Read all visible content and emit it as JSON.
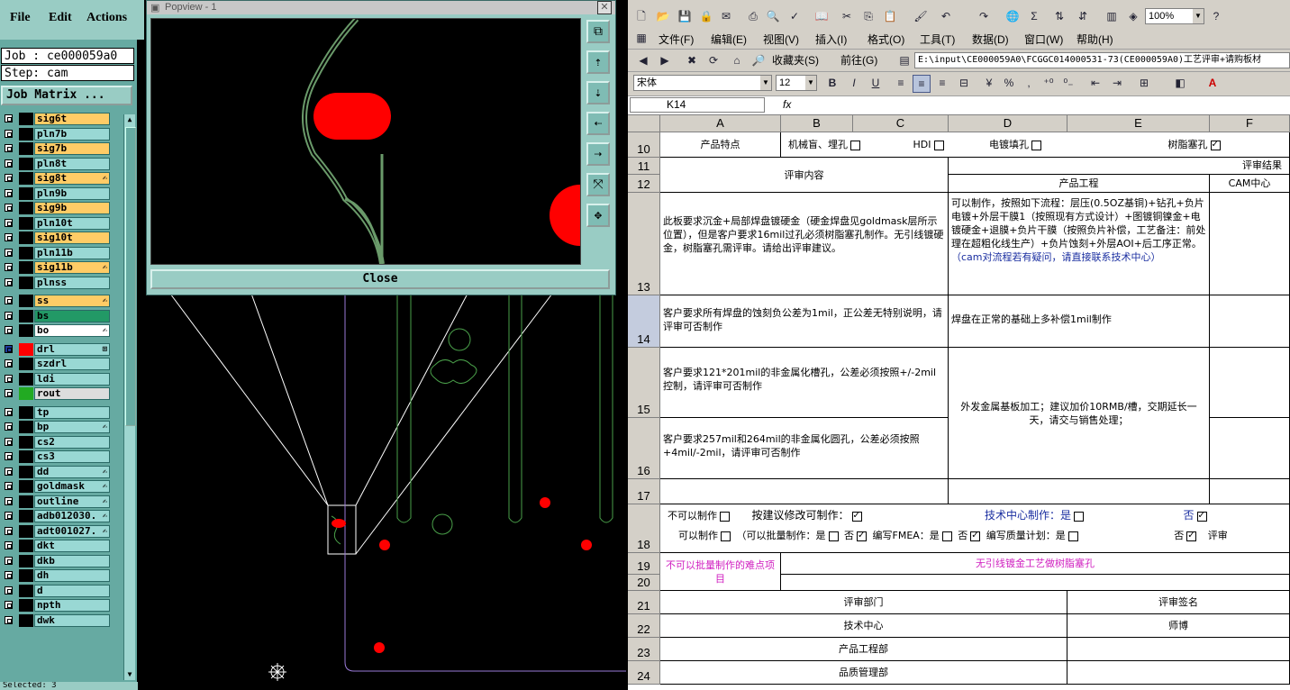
{
  "cam": {
    "menu": {
      "file": "File",
      "edit": "Edit",
      "actions": "Actions"
    },
    "job_label": "Job : ce000059a0",
    "step_label": "Step: cam",
    "job_matrix_button": "Job Matrix ...",
    "layers": [
      {
        "name": "sig6t",
        "color": "#ffcc66",
        "flag": ""
      },
      {
        "name": "pln7b",
        "color": "#99d8d4",
        "flag": ""
      },
      {
        "name": "sig7b",
        "color": "#ffcc66",
        "flag": ""
      },
      {
        "name": "pln8t",
        "color": "#99d8d4",
        "flag": ""
      },
      {
        "name": "sig8t",
        "color": "#ffcc66",
        "flag": "✍"
      },
      {
        "name": "pln9b",
        "color": "#99d8d4",
        "flag": ""
      },
      {
        "name": "sig9b",
        "color": "#ffcc66",
        "flag": ""
      },
      {
        "name": "pln10t",
        "color": "#99d8d4",
        "flag": ""
      },
      {
        "name": "sig10t",
        "color": "#ffcc66",
        "flag": ""
      },
      {
        "name": "pln11b",
        "color": "#99d8d4",
        "flag": ""
      },
      {
        "name": "sig11b",
        "color": "#ffcc66",
        "flag": "✍"
      },
      {
        "name": "plnss",
        "color": "#99d8d4",
        "flag": ""
      },
      {
        "name": "ss",
        "color": "#ffcc66",
        "flag": "✍"
      },
      {
        "name": "bs",
        "color": "#229966",
        "flag": ""
      },
      {
        "name": "bo",
        "color": "#ffffff",
        "flag": "✍"
      },
      {
        "name": "drl",
        "color": "#99d8d4",
        "flag": "⊞"
      },
      {
        "name": "szdrl",
        "color": "#99d8d4",
        "flag": ""
      },
      {
        "name": "ldi",
        "color": "#99d8d4",
        "flag": ""
      },
      {
        "name": "rout",
        "color": "#dddddd",
        "flag": ""
      },
      {
        "name": "tp",
        "color": "#99d8d4",
        "flag": ""
      },
      {
        "name": "bp",
        "color": "#99d8d4",
        "flag": "✍"
      },
      {
        "name": "cs2",
        "color": "#99d8d4",
        "flag": ""
      },
      {
        "name": "cs3",
        "color": "#99d8d4",
        "flag": ""
      },
      {
        "name": "dd",
        "color": "#99d8d4",
        "flag": "✍"
      },
      {
        "name": "goldmask",
        "color": "#99d8d4",
        "flag": "✍"
      },
      {
        "name": "outline",
        "color": "#99d8d4",
        "flag": "✍"
      },
      {
        "name": "adb012030.",
        "color": "#99d8d4",
        "flag": "✍"
      },
      {
        "name": "adt001027.",
        "color": "#99d8d4",
        "flag": "✍"
      },
      {
        "name": "dkt",
        "color": "#99d8d4",
        "flag": ""
      },
      {
        "name": "dkb",
        "color": "#99d8d4",
        "flag": ""
      },
      {
        "name": "dh",
        "color": "#99d8d4",
        "flag": ""
      },
      {
        "name": "d",
        "color": "#99d8d4",
        "flag": ""
      },
      {
        "name": "npth",
        "color": "#99d8d4",
        "flag": ""
      },
      {
        "name": "dwk",
        "color": "#99d8d4",
        "flag": ""
      }
    ],
    "status_text": "Selected: 3",
    "popview": {
      "title": "Popview - 1",
      "close_button": "Close"
    }
  },
  "excel": {
    "menu": [
      "文件(F)",
      "编辑(E)",
      "视图(V)",
      "插入(I)",
      "格式(O)",
      "工具(T)",
      "数据(D)",
      "窗口(W)",
      "帮助(H)"
    ],
    "zoom": "100%",
    "web_favorites": "收藏夹(S)",
    "web_goto": "前往(G)",
    "address": "E:\\input\\CE000059A0\\FCGGC014000531-73(CE000059A0)工艺评审+请购板材",
    "font_name": "宋体",
    "font_size": "12",
    "name_box": "K14",
    "fx": "fx",
    "columns": [
      "A",
      "B",
      "C",
      "D",
      "E",
      "F"
    ],
    "rows": [
      "10",
      "11",
      "12",
      "13",
      "14",
      "15",
      "16",
      "17",
      "18",
      "19",
      "20",
      "21",
      "22",
      "23",
      "24"
    ],
    "r10": {
      "a": "产品特点",
      "b": "机械盲、埋孔",
      "hdi": "HDI",
      "plating": "电镀填孔",
      "resin": "树脂塞孔"
    },
    "review_content": "评审内容",
    "review_result": "评审结果",
    "prod_eng": "产品工程",
    "cam_center": "CAM中心",
    "r13_a": "此板要求沉金+局部焊盘镀硬金（硬金焊盘见goldmask层所示位置），但是客户要求16mil过孔必须树脂塞孔制作。无引线镀硬金，树脂塞孔需评审。请给出评审建议。",
    "r13_d": "可以制作，按照如下流程：层压(0.5OZ基铜)+钻孔+负片电镀+外层干膜1（按照现有方式设计）+图镀铜镍金+电镀硬金+退膜+负片干膜（按照负片补偿，工艺备注：前处理在超粗化线生产）+负片蚀刻+外层AOI+后工序正常。",
    "r13_d_note": "（cam对流程若有疑问，请直接联系技术中心）",
    "r14_a": "客户要求所有焊盘的蚀刻负公差为1mil，正公差无特别说明，请评审可否制作",
    "r14_d": "焊盘在正常的基础上多补偿1mil制作",
    "r15_a": "客户要求121*201mil的非金属化槽孔，公差必须按照+/-2mil控制，请评审可否制作",
    "r1516_d": "外发金属基板加工；建议加价10RMB/槽，交期延长一天，请交与销售处理；",
    "r16_a": "客户要求257mil和264mil的非金属化圆孔，公差必须按照+4mil/-2mil，请评审可否制作",
    "r18": {
      "cannot": "不可以制作",
      "suggest": "按建议修改可制作：",
      "tech": "技术中心制作：是",
      "no": "否",
      "can": "可以制作",
      "batch": "（可以批量制作：是",
      "no2": "否",
      "fmea": "编写FMEA：是",
      "no3": "否",
      "qplan": "编写质量计划：是",
      "no4": "否",
      "review": "评审"
    },
    "r19_a": "不可以批量制作的难点项目",
    "r19_b": "无引线镀金工艺做树脂塞孔",
    "dept_header": "评审部门",
    "sign_header": "评审签名",
    "dept_tech": "技术中心",
    "sign_tech": "师博",
    "dept_prod": "产品工程部",
    "dept_quality": "品质管理部"
  }
}
